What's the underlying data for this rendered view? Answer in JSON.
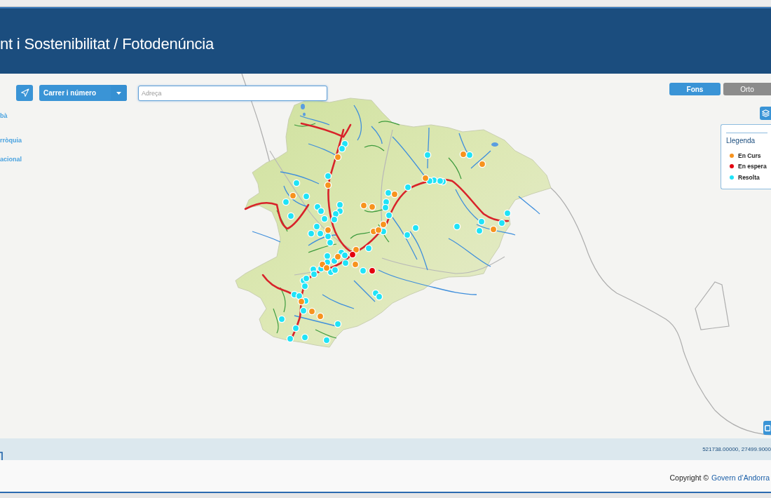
{
  "header": {
    "title": "nt i Sostenibilitat / Fotodenúncia"
  },
  "side_links": [
    "bà",
    "rròquia",
    "acional"
  ],
  "search": {
    "mode_dropdown": {
      "value": "Carrer i número"
    },
    "address_field": {
      "placeholder": "Adreça"
    }
  },
  "basemap_tabs": [
    {
      "label": "Fons",
      "selected": true
    },
    {
      "label": "Orto",
      "selected": false
    }
  ],
  "legend": {
    "title": "Llegenda",
    "items": [
      {
        "label": "En Curs",
        "color": "#f7931e"
      },
      {
        "label": "En espera",
        "color": "#e3000f"
      },
      {
        "label": "Resolta",
        "color": "#1fe3f7"
      }
    ]
  },
  "coordinates": "521738.00000, 27499.9000",
  "footer": {
    "copyright": "Copyright ©",
    "link": "Govern d’Andorra"
  }
}
